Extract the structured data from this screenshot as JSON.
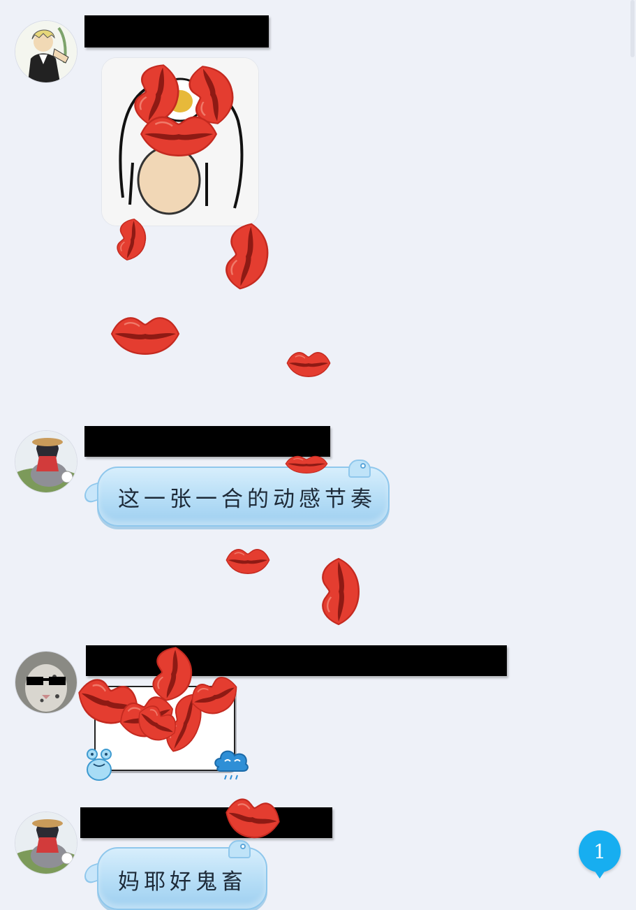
{
  "colors": {
    "background": "#eef1f8",
    "bubble": "#b5ddf6",
    "bubble_border": "#8fc7ec",
    "redaction": "#000000",
    "lip": "#e03a2e",
    "unread_badge": "#17aef0"
  },
  "messages": [
    {
      "avatar_icon": "anime-man-avatar-icon",
      "content_type": "sticker",
      "sticker_icon": "cartoon-character-sticker-icon"
    },
    {
      "avatar_icon": "anime-girl-rabbit-avatar-icon",
      "content_type": "text",
      "text": "这一张一合的动感节奏"
    },
    {
      "avatar_icon": "snow-leopard-sunglasses-avatar-icon",
      "content_type": "sticker",
      "sticker_icon": "frog-and-cloud-card-icon"
    },
    {
      "avatar_icon": "anime-girl-rabbit-avatar-icon",
      "content_type": "text",
      "text": "妈耶好鬼畜"
    }
  ],
  "effects": {
    "icon": "red-lips-icon"
  },
  "unread_badge": {
    "count": "1"
  }
}
